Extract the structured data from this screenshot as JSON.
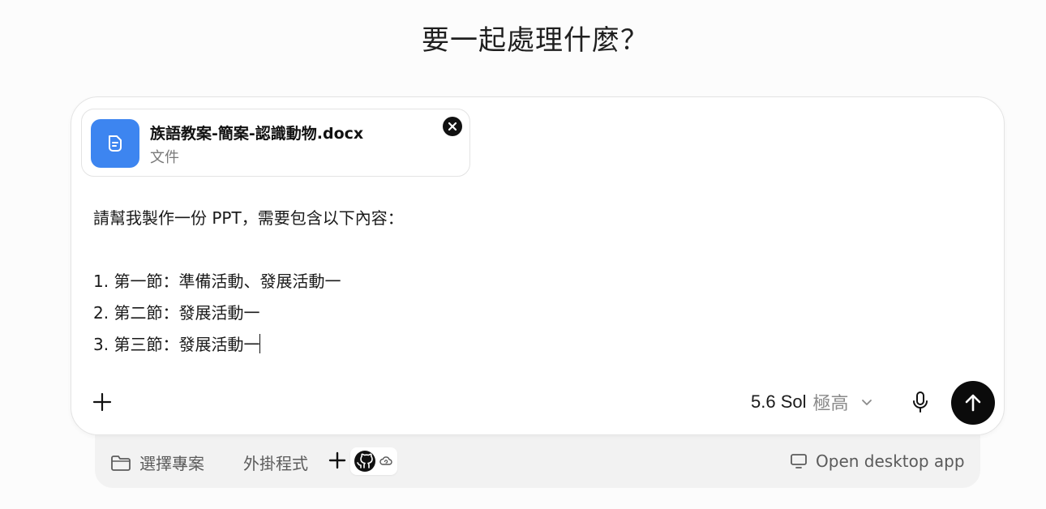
{
  "headline": "要一起處理什麼？",
  "attachment": {
    "file_name": "族語教案-簡案-認識動物.docx",
    "file_type": "文件",
    "icon": "document-icon",
    "remove_icon": "close-circle-icon"
  },
  "prompt": {
    "text": "請幫我製作一份 PPT，需要包含以下內容：\n\n1. 第一節：準備活動、發展活動一\n2. 第二節：發展活動一\n3. 第三節：發展活動一"
  },
  "toolbar": {
    "add_icon": "plus-icon",
    "model_name": "5.6 Sol",
    "model_effort": "極高",
    "dropdown_icon": "chevron-down-icon",
    "mic_icon": "microphone-icon",
    "send_icon": "arrow-up-icon"
  },
  "footer": {
    "project_label": "選擇專案",
    "project_icon": "folder-icon",
    "plugins_label": "外掛程式",
    "plugin_add_icon": "plus-icon",
    "plugin_icons": [
      "github-icon",
      "cloud-sync-icon"
    ],
    "desktop_label": "Open desktop app",
    "desktop_icon": "monitor-icon"
  },
  "colors": {
    "accent": "#3d85f0",
    "send_button": "#0b0b0b",
    "footer_bg": "#f2f2f2"
  }
}
